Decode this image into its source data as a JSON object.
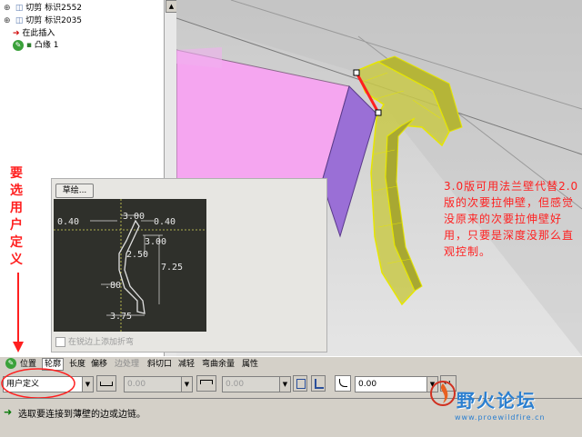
{
  "model_tree": {
    "items": [
      {
        "label": "切剪 标识2552",
        "icon": "cut-feature-icon"
      },
      {
        "label": "切剪 标识2035",
        "icon": "cut-feature-icon"
      },
      {
        "label": "在此插入",
        "icon": "insert-here-arrow-icon"
      },
      {
        "label": "凸缘 1",
        "icon": "flange-feature-icon"
      }
    ]
  },
  "viewport": {
    "annotation": "3.0版可用法兰壁代替2.0版的次要拉伸壁，但感觉没原来的次要拉伸壁好用，只要是深度没那么直观控制。",
    "side_hint": "要选用户定义"
  },
  "sketch_panel": {
    "sketch_button": "草绘...",
    "dims": [
      "0.40",
      "3.00",
      "0.40",
      "3.00",
      "2.50",
      "7.25",
      ".80",
      "3.75"
    ],
    "no_fold_label": "在锐边上添加折弯"
  },
  "tabs": [
    {
      "label": "位置",
      "state": "normal"
    },
    {
      "label": "轮廓",
      "state": "active"
    },
    {
      "label": "长度",
      "state": "normal"
    },
    {
      "label": "偏移",
      "state": "normal"
    },
    {
      "label": "边处理",
      "state": "disabled"
    },
    {
      "label": "斜切口",
      "state": "normal"
    },
    {
      "label": "减轻",
      "state": "normal"
    },
    {
      "label": "弯曲余量",
      "state": "normal"
    },
    {
      "label": "属性",
      "state": "normal"
    }
  ],
  "controls": {
    "profile_type": "用户定义",
    "length1": "0.00",
    "length2": "0.00",
    "radius": "0.00"
  },
  "status": {
    "message": "选取要连接到薄壁的边或边链。"
  },
  "watermark": {
    "logo": "野火论坛",
    "url": "www.proewildfire.cn"
  },
  "colors": {
    "annotation_red": "#ff1f1f",
    "part_yellow": "#e6e600",
    "wall_pink": "#f5a6f0",
    "wall_purple": "#9a6fd6",
    "sketch_bg": "#2f302b",
    "logo_blue": "#2b7fd0"
  }
}
